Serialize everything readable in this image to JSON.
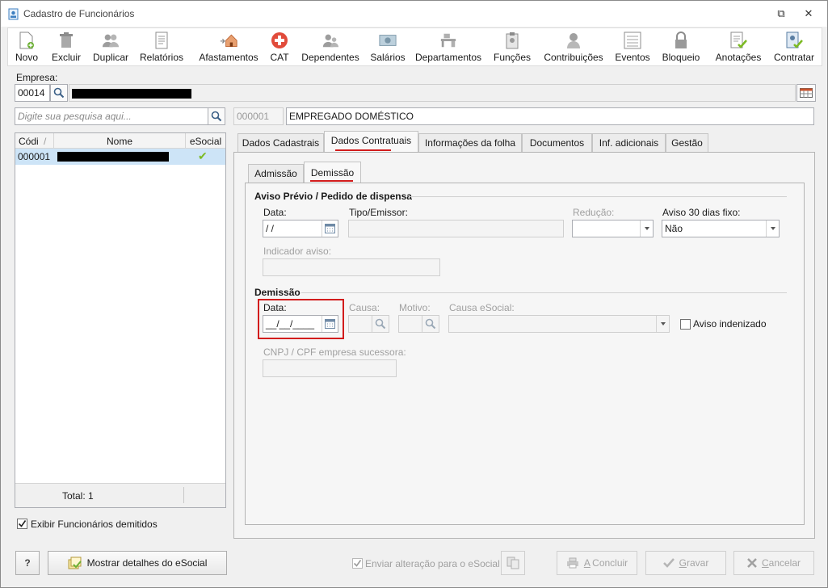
{
  "window": {
    "title": "Cadastro de Funcionários",
    "controls": [
      "⧉",
      "✕"
    ]
  },
  "toolbar": [
    {
      "id": "novo",
      "label": "Novo",
      "icon": "new-document-icon"
    },
    {
      "id": "excluir",
      "label": "Excluir",
      "icon": "trash-icon"
    },
    {
      "id": "duplicar",
      "label": "Duplicar",
      "icon": "people-icon"
    },
    {
      "id": "relatorios",
      "label": "Relatórios",
      "icon": "report-icon"
    },
    {
      "id": "afastamentos",
      "label": "Afastamentos",
      "icon": "house-arrow-icon"
    },
    {
      "id": "cat",
      "label": "CAT",
      "icon": "medical-cross-icon"
    },
    {
      "id": "dependentes",
      "label": "Dependentes",
      "icon": "dependents-icon"
    },
    {
      "id": "salarios",
      "label": "Salários",
      "icon": "money-icon"
    },
    {
      "id": "departamentos",
      "label": "Departamentos",
      "icon": "desk-icon"
    },
    {
      "id": "funcoes",
      "label": "Funções",
      "icon": "badge-icon"
    },
    {
      "id": "contribuicoes",
      "label": "Contribuições",
      "icon": "contribution-icon"
    },
    {
      "id": "eventos",
      "label": "Eventos",
      "icon": "list-icon"
    },
    {
      "id": "bloqueio",
      "label": "Bloqueio",
      "icon": "lock-icon"
    },
    {
      "id": "anotacoes",
      "label": "Anotações",
      "icon": "note-check-icon"
    },
    {
      "id": "contratar",
      "label": "Contratar",
      "icon": "contract-check-icon"
    }
  ],
  "empresa": {
    "label": "Empresa:",
    "code": "00014",
    "name": ""
  },
  "search": {
    "placeholder": "Digite sua pesquisa aqui..."
  },
  "employee": {
    "code": "000001",
    "role": "EMPREGADO DOMÉSTICO"
  },
  "list": {
    "columns": [
      "Códi",
      "Nome",
      "eSocial"
    ],
    "rows": [
      {
        "code": "000001",
        "name": "",
        "esocial": "✔"
      }
    ],
    "total": "Total: 1"
  },
  "show_dismissed": {
    "label": "Exibir Funcionários demitidos",
    "checked": true
  },
  "tabs": [
    "Dados Cadastrais",
    "Dados Contratuais",
    "Informações da folha",
    "Documentos",
    "Inf. adicionais",
    "Gestão"
  ],
  "active_tab": "Dados Contratuais",
  "subtabs": [
    "Admissão",
    "Demissão"
  ],
  "active_subtab": "Demissão",
  "aviso": {
    "title": "Aviso Prévio / Pedido de dispensa",
    "data_label": "Data:",
    "data_value": " /  /",
    "tipo_label": "Tipo/Emissor:",
    "tipo_value": "",
    "reducao_label": "Redução:",
    "reducao_value": "",
    "aviso30_label": "Aviso 30 dias fixo:",
    "aviso30_value": "Não",
    "indicador_label": "Indicador aviso:",
    "indicador_value": ""
  },
  "demissao": {
    "title": "Demissão",
    "data_label": "Data:",
    "data_value": "__/__/____",
    "causa_label": "Causa:",
    "motivo_label": "Motivo:",
    "causa_esocial_label": "Causa eSocial:",
    "aviso_indenizado_label": "Aviso indenizado",
    "aviso_indenizado_checked": false,
    "cnpj_label": "CNPJ / CPF empresa sucessora:",
    "cnpj_value": ""
  },
  "footer": {
    "help": "?",
    "esocial_details": "Mostrar detalhes do eSocial",
    "enviar_label": "Enviar alteração para o eSocial",
    "enviar_checked": true,
    "concluir": "Concluir",
    "concluir_key": "A",
    "gravar": "Gravar",
    "gravar_key": "G",
    "cancelar": "Cancelar",
    "cancelar_key": "C"
  },
  "colors": {
    "accent_red": "#d21c1c",
    "selection": "#cde4f7",
    "check_green": "#7cba23"
  }
}
